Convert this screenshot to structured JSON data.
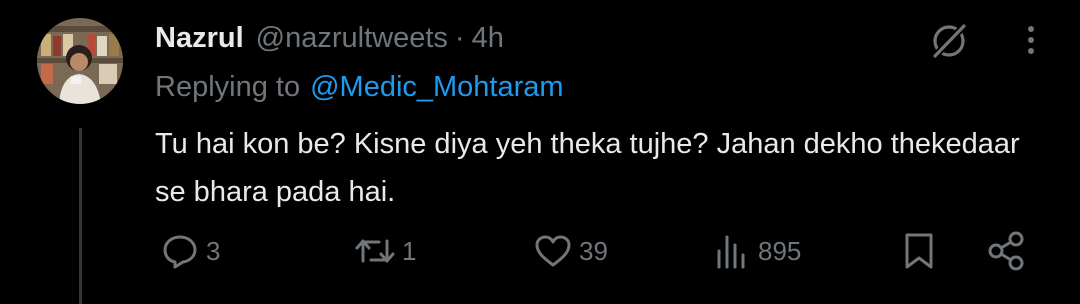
{
  "tweet": {
    "author_name": "Nazrul",
    "handle": "@nazrultweets",
    "separator": "·",
    "time": "4h",
    "replying_prefix": "Replying to",
    "replying_to": "@Medic_Mohtaram",
    "text": "Tu hai kon be? Kisne diya yeh theka tujhe? Jahan dekho thekedaar se bhara pada hai."
  },
  "actions": {
    "replies": "3",
    "reposts": "1",
    "likes": "39",
    "views": "895"
  },
  "icons": {
    "grok": "grok-icon",
    "more": "more-vertical-icon",
    "reply": "reply-icon",
    "repost": "repost-icon",
    "like": "heart-icon",
    "views": "views-icon",
    "bookmark": "bookmark-icon",
    "share": "share-icon"
  },
  "colors": {
    "background": "#000000",
    "text": "#e7e9ea",
    "muted": "#71767b",
    "link": "#1d9bf0"
  }
}
